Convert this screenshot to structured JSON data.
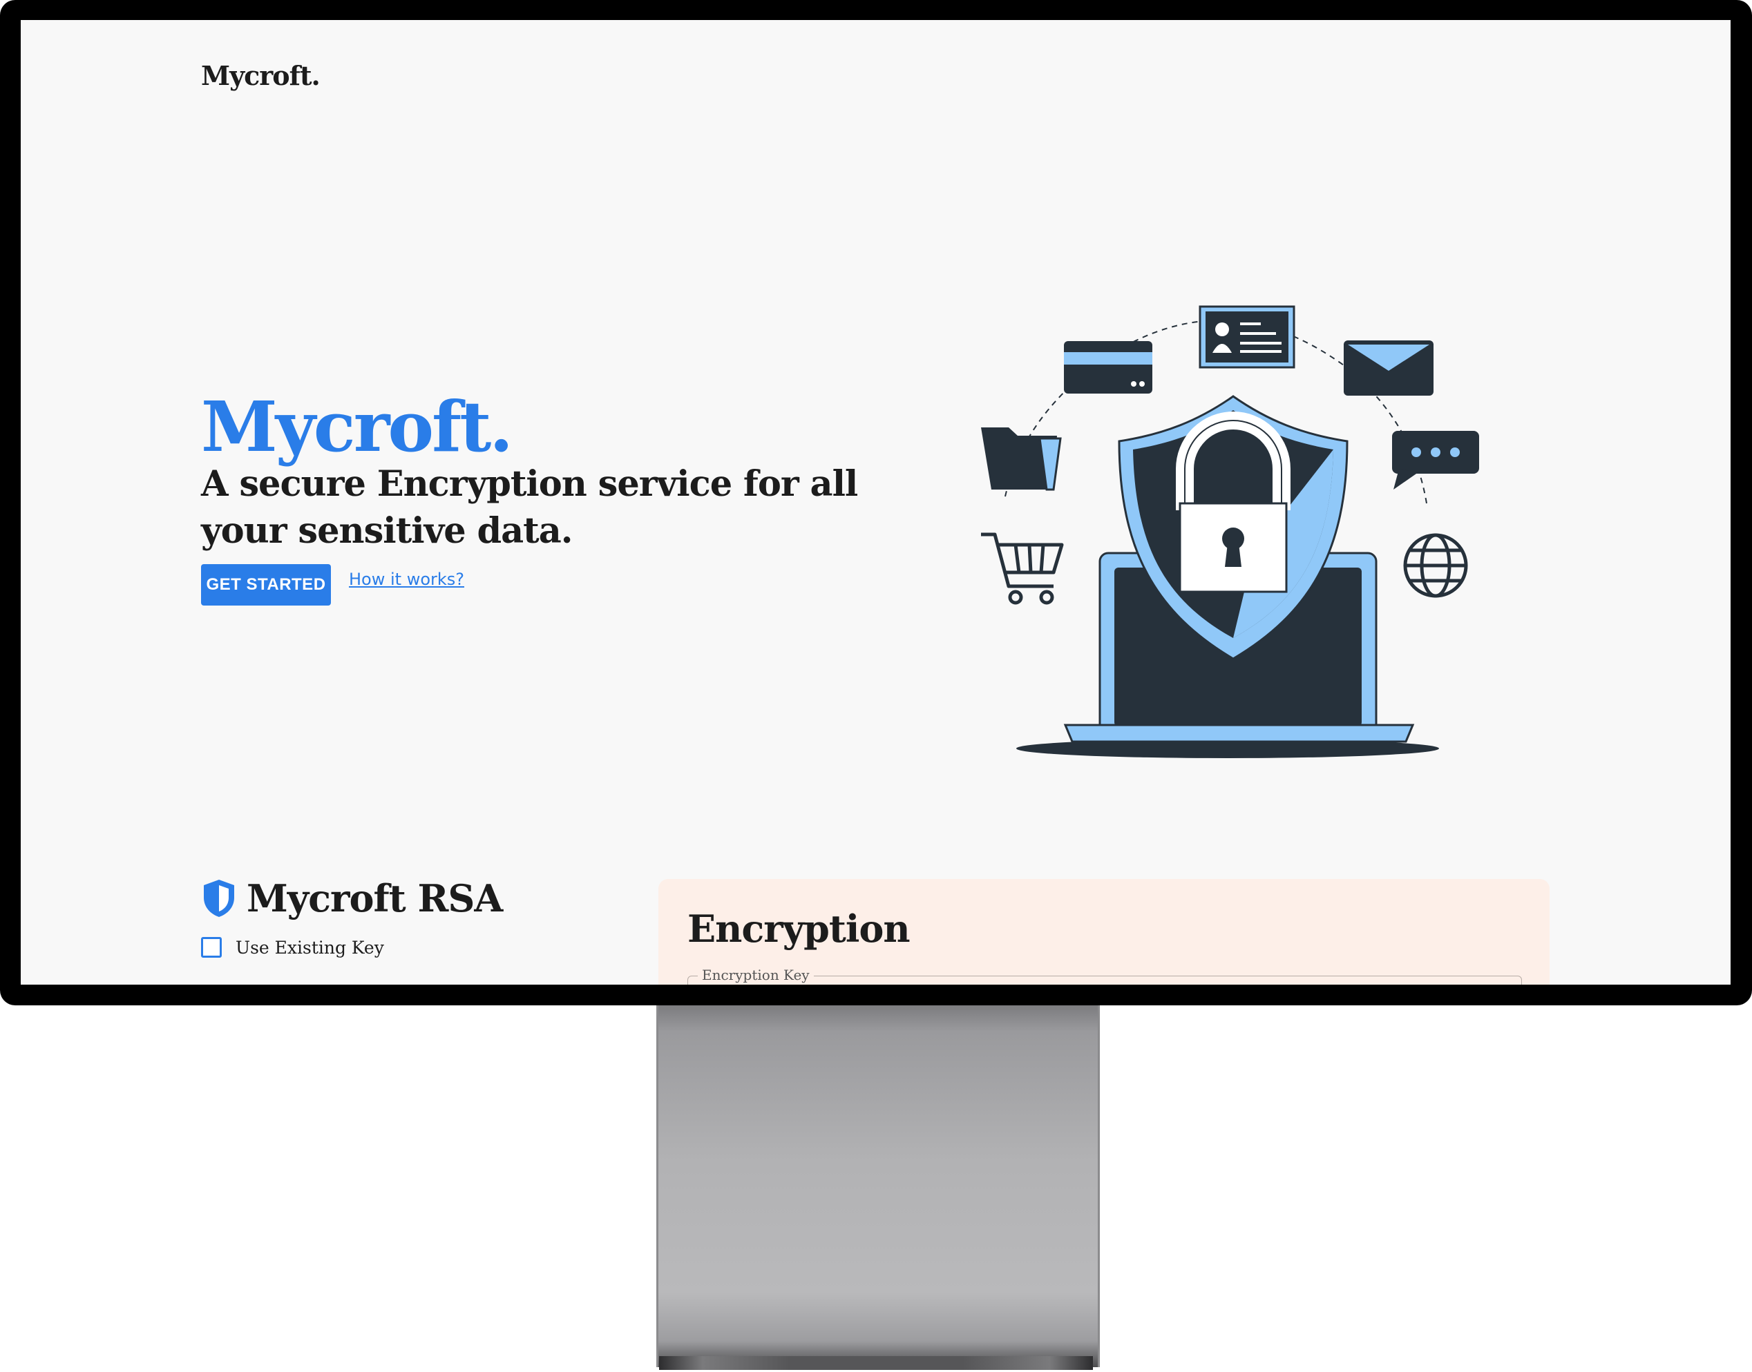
{
  "header": {
    "brand": "Mycroft."
  },
  "hero": {
    "title": "Mycroft.",
    "subtitle": "A secure Encryption service for all your sensitive data.",
    "cta_label": "GET STARTED",
    "link_label": "How it works?"
  },
  "rsa": {
    "title": "Mycroft RSA",
    "checkbox_label": "Use Existing Key",
    "checkbox_checked": false
  },
  "encryption": {
    "title": "Encryption",
    "key_field_label": "Encryption Key"
  },
  "colors": {
    "accent": "#2a7de8",
    "illustration_dark": "#26313b",
    "illustration_light": "#90c8f8",
    "card_bg": "#fdefe8",
    "page_bg": "#f8f8f8"
  },
  "icons": [
    "shield-icon",
    "lock-icon",
    "credit-card-icon",
    "id-card-icon",
    "mail-icon",
    "folder-icon",
    "chat-icon",
    "cart-icon",
    "globe-icon",
    "laptop-icon"
  ]
}
